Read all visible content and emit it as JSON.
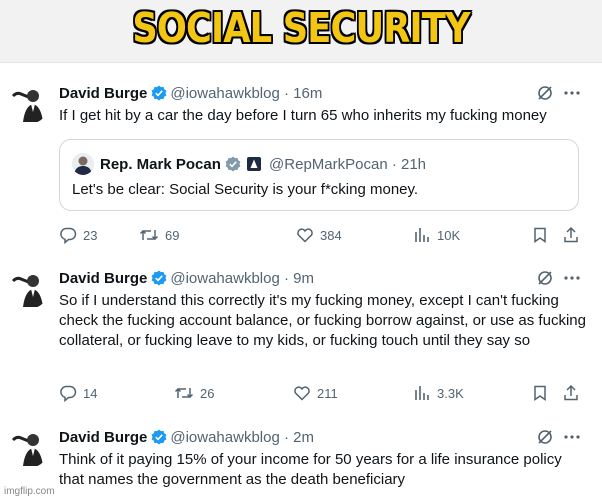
{
  "banner": {
    "title": "SOCIAL SECURITY"
  },
  "tweets": [
    {
      "name": "David Burge",
      "handle": "@iowahawkblog",
      "time": "· 16m",
      "text": "If I get hit by a car the day before I turn 65 who inherits my fucking money",
      "quote": {
        "name": "Rep. Mark Pocan",
        "handle": "@RepMarkPocan",
        "time": "· 21h",
        "text": "Let's be clear: Social Security is your f*cking money."
      },
      "replies": "23",
      "reposts": "69",
      "likes": "384",
      "views": "10K"
    },
    {
      "name": "David Burge",
      "handle": "@iowahawkblog",
      "time": "· 9m",
      "text": "So if I understand this correctly it's my fucking money, except I can't fucking check the fucking account balance, or fucking borrow against, or use as fucking collateral, or fucking leave to my kids, or fucking touch until they say so",
      "replies": "14",
      "reposts": "26",
      "likes": "211",
      "views": "3.3K"
    },
    {
      "name": "David Burge",
      "handle": "@iowahawkblog",
      "time": "· 2m",
      "text": "Think of it paying 15% of your income for 50 years for a life insurance policy that names the government as the death beneficiary"
    }
  ],
  "watermark": "imgflip.com",
  "icons": [
    "grok-icon",
    "more-icon",
    "reply-icon",
    "repost-icon",
    "like-icon",
    "views-icon",
    "bookmark-icon",
    "share-icon",
    "verified-badge-icon",
    "gov-badge-icon"
  ],
  "colors": {
    "banner_text": "#f3c614",
    "verified": "#1d9bf0",
    "secondary": "#536471"
  }
}
